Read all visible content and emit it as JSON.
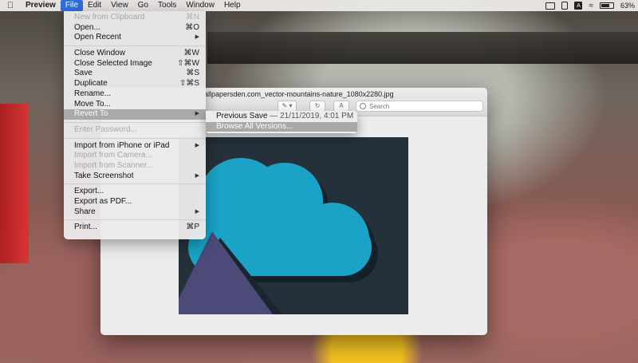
{
  "menubar": {
    "app": "Preview",
    "items": [
      "File",
      "Edit",
      "View",
      "Go",
      "Tools",
      "Window",
      "Help"
    ],
    "active": "File",
    "battery": "63%"
  },
  "window": {
    "filename": "allpapersden.com_vector-mountains-nature_1080x2280.jpg",
    "search_placeholder": "Search"
  },
  "file_menu": {
    "items": [
      {
        "label": "New from Clipboard",
        "shortcut": "⌘N",
        "disabled": true
      },
      {
        "label": "Open...",
        "shortcut": "⌘O"
      },
      {
        "label": "Open Recent",
        "submenu": true
      },
      {
        "sep": true
      },
      {
        "label": "Close Window",
        "shortcut": "⌘W"
      },
      {
        "label": "Close Selected Image",
        "shortcut": "⇧⌘W"
      },
      {
        "label": "Save",
        "shortcut": "⌘S"
      },
      {
        "label": "Duplicate",
        "shortcut": "⇧⌘S"
      },
      {
        "label": "Rename..."
      },
      {
        "label": "Move To..."
      },
      {
        "label": "Revert To",
        "submenu": true,
        "selected": true
      },
      {
        "sep": true
      },
      {
        "label": "Enter Password...",
        "disabled": true
      },
      {
        "sep": true
      },
      {
        "label": "Import from iPhone or iPad",
        "submenu": true
      },
      {
        "label": "Import from Camera...",
        "disabled": true
      },
      {
        "label": "Import from Scanner...",
        "disabled": true
      },
      {
        "label": "Take Screenshot",
        "submenu": true
      },
      {
        "sep": true
      },
      {
        "label": "Export..."
      },
      {
        "label": "Export as PDF..."
      },
      {
        "label": "Share",
        "submenu": true
      },
      {
        "sep": true
      },
      {
        "label": "Print...",
        "shortcut": "⌘P"
      }
    ]
  },
  "revert_submenu": {
    "previous_save_label": "Previous Save",
    "previous_save_date": "— 21/11/2019, 4:01 PM",
    "browse_label": "Browse All Versions..."
  },
  "colors": {
    "accent": "#2f6fd6",
    "cloud": "#1aa3c6",
    "mountain": "#4b4a78",
    "canvas_bg": "#25313a"
  },
  "icons": [
    "apple-icon",
    "display-icon",
    "phone-icon",
    "text-input-icon",
    "wifi-icon",
    "battery-icon",
    "search-icon",
    "pen-icon",
    "rotate-icon",
    "markup-icon"
  ]
}
